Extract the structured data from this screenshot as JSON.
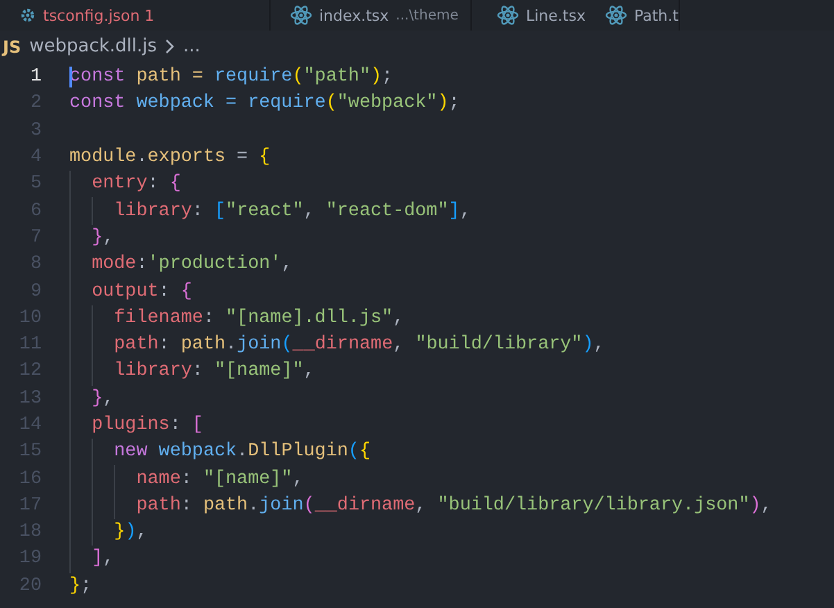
{
  "tabs": [
    {
      "label": "tsconfig.json",
      "badge": "1",
      "kind": "config",
      "error": true
    },
    {
      "label": "index.tsx",
      "detail": "...\\theme",
      "kind": "react",
      "error": false
    },
    {
      "label": "Line.tsx",
      "kind": "react",
      "error": false
    },
    {
      "label": "Path.t",
      "kind": "react",
      "error": false
    }
  ],
  "breadcrumb": {
    "file_icon": "JS",
    "file": "webpack.dll.js",
    "more": "..."
  },
  "lines": [
    {
      "number": "1",
      "active": true,
      "tokens": [
        {
          "kind": "kw",
          "text": "const "
        },
        {
          "kind": "var",
          "text": "path = "
        },
        {
          "kind": "fn",
          "text": "require"
        },
        {
          "kind": "b1",
          "text": "("
        },
        {
          "kind": "str",
          "text": "\"path\""
        },
        {
          "kind": "b1",
          "text": ")"
        },
        {
          "kind": "pl",
          "text": ";"
        }
      ]
    },
    {
      "number": "2",
      "active": false,
      "tokens": [
        {
          "kind": "kw",
          "text": "const "
        },
        {
          "kind": "cls",
          "text": "webpack = "
        },
        {
          "kind": "fn",
          "text": "require"
        },
        {
          "kind": "b1",
          "text": "("
        },
        {
          "kind": "str",
          "text": "\"webpack\""
        },
        {
          "kind": "b1",
          "text": ")"
        },
        {
          "kind": "pl",
          "text": ";"
        }
      ]
    },
    {
      "number": "3",
      "active": false
    },
    {
      "number": "4",
      "active": false,
      "tokens": [
        {
          "kind": "var",
          "text": "module"
        },
        {
          "kind": "pl",
          "text": "."
        },
        {
          "kind": "var",
          "text": "exports"
        },
        {
          "kind": "pl",
          "text": " = "
        },
        {
          "kind": "b1",
          "text": "{"
        }
      ]
    },
    {
      "number": "5",
      "active": false,
      "tokens": [
        {
          "kind": "prop",
          "text": "  entry"
        },
        {
          "kind": "pl",
          "text": ": "
        },
        {
          "kind": "b2",
          "text": "{"
        }
      ]
    },
    {
      "number": "6",
      "active": false,
      "tokens": [
        {
          "kind": "prop",
          "text": "    library"
        },
        {
          "kind": "pl",
          "text": ": "
        },
        {
          "kind": "b3",
          "text": "["
        },
        {
          "kind": "str",
          "text": "\"react\""
        },
        {
          "kind": "pl",
          "text": ", "
        },
        {
          "kind": "str",
          "text": "\"react-dom\""
        },
        {
          "kind": "b3",
          "text": "]"
        },
        {
          "kind": "pl",
          "text": ","
        }
      ]
    },
    {
      "number": "7",
      "active": false,
      "tokens": [
        {
          "kind": "b2",
          "text": "  }"
        },
        {
          "kind": "pl",
          "text": ","
        }
      ]
    },
    {
      "number": "8",
      "active": false,
      "tokens": [
        {
          "kind": "prop",
          "text": "  mode"
        },
        {
          "kind": "pl",
          "text": ":"
        },
        {
          "kind": "str",
          "text": "'production'"
        },
        {
          "kind": "pl",
          "text": ","
        }
      ]
    },
    {
      "number": "9",
      "active": false,
      "tokens": [
        {
          "kind": "prop",
          "text": "  output"
        },
        {
          "kind": "pl",
          "text": ": "
        },
        {
          "kind": "b2",
          "text": "{"
        }
      ]
    },
    {
      "number": "10",
      "active": false,
      "tokens": [
        {
          "kind": "prop",
          "text": "    filename"
        },
        {
          "kind": "pl",
          "text": ": "
        },
        {
          "kind": "str",
          "text": "\"[name].dll.js\""
        },
        {
          "kind": "pl",
          "text": ","
        }
      ]
    },
    {
      "number": "11",
      "active": false,
      "tokens": [
        {
          "kind": "prop",
          "text": "    path"
        },
        {
          "kind": "pl",
          "text": ": "
        },
        {
          "kind": "var",
          "text": "path"
        },
        {
          "kind": "pl",
          "text": "."
        },
        {
          "kind": "fn",
          "text": "join"
        },
        {
          "kind": "b3",
          "text": "("
        },
        {
          "kind": "prop",
          "text": "__dirname"
        },
        {
          "kind": "pl",
          "text": ", "
        },
        {
          "kind": "str",
          "text": "\"build/library\""
        },
        {
          "kind": "b3",
          "text": ")"
        },
        {
          "kind": "pl",
          "text": ","
        }
      ]
    },
    {
      "number": "12",
      "active": false,
      "tokens": [
        {
          "kind": "prop",
          "text": "    library"
        },
        {
          "kind": "pl",
          "text": ": "
        },
        {
          "kind": "str",
          "text": "\"[name]\""
        },
        {
          "kind": "pl",
          "text": ","
        }
      ]
    },
    {
      "number": "13",
      "active": false,
      "tokens": [
        {
          "kind": "b2",
          "text": "  }"
        },
        {
          "kind": "pl",
          "text": ","
        }
      ]
    },
    {
      "number": "14",
      "active": false,
      "tokens": [
        {
          "kind": "prop",
          "text": "  plugins"
        },
        {
          "kind": "pl",
          "text": ": "
        },
        {
          "kind": "b2",
          "text": "["
        }
      ]
    },
    {
      "number": "15",
      "active": false,
      "tokens": [
        {
          "kind": "kw",
          "text": "    new "
        },
        {
          "kind": "cls",
          "text": "webpack"
        },
        {
          "kind": "pl",
          "text": "."
        },
        {
          "kind": "var",
          "text": "DllPlugin"
        },
        {
          "kind": "b3",
          "text": "("
        },
        {
          "kind": "b1",
          "text": "{"
        }
      ]
    },
    {
      "number": "16",
      "active": false,
      "tokens": [
        {
          "kind": "prop",
          "text": "      name"
        },
        {
          "kind": "pl",
          "text": ": "
        },
        {
          "kind": "str",
          "text": "\"[name]\""
        },
        {
          "kind": "pl",
          "text": ","
        }
      ]
    },
    {
      "number": "17",
      "active": false,
      "tokens": [
        {
          "kind": "prop",
          "text": "      path"
        },
        {
          "kind": "pl",
          "text": ": "
        },
        {
          "kind": "var",
          "text": "path"
        },
        {
          "kind": "pl",
          "text": "."
        },
        {
          "kind": "fn",
          "text": "join"
        },
        {
          "kind": "b2",
          "text": "("
        },
        {
          "kind": "prop",
          "text": "__dirname"
        },
        {
          "kind": "pl",
          "text": ", "
        },
        {
          "kind": "str",
          "text": "\"build/library/library.json\""
        },
        {
          "kind": "b2",
          "text": ")"
        },
        {
          "kind": "pl",
          "text": ","
        }
      ]
    },
    {
      "number": "18",
      "active": false,
      "tokens": [
        {
          "kind": "b1",
          "text": "    }"
        },
        {
          "kind": "b3",
          "text": ")"
        },
        {
          "kind": "pl",
          "text": ","
        }
      ]
    },
    {
      "number": "19",
      "active": false,
      "tokens": [
        {
          "kind": "b2",
          "text": "  ]"
        },
        {
          "kind": "pl",
          "text": ","
        }
      ]
    },
    {
      "number": "20",
      "active": false,
      "tokens": [
        {
          "kind": "b1",
          "text": "}"
        },
        {
          "kind": "pl",
          "text": ";"
        }
      ]
    }
  ]
}
